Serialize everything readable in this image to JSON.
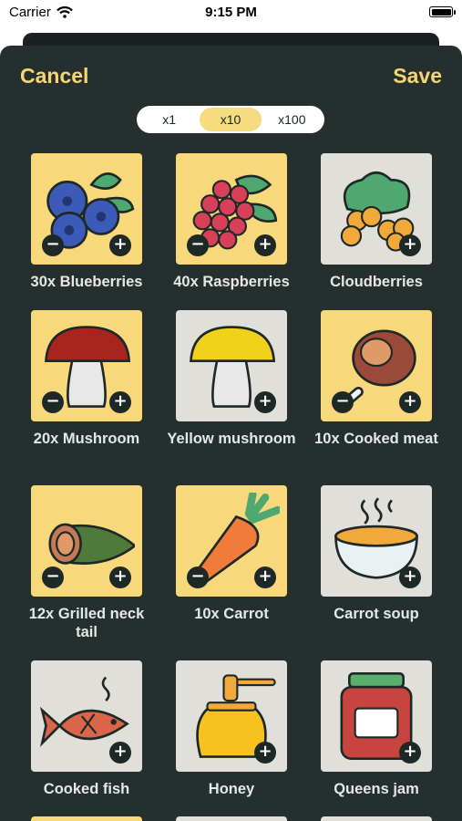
{
  "status_bar": {
    "carrier": "Carrier",
    "time": "9:15 PM"
  },
  "header": {
    "cancel_label": "Cancel",
    "save_label": "Save"
  },
  "multiplier": {
    "options": [
      "x1",
      "x10",
      "x100"
    ],
    "selected": "x10"
  },
  "items": [
    {
      "label": "30x Blueberries",
      "icon": "blueberries-icon",
      "selected": true
    },
    {
      "label": "40x Raspberries",
      "icon": "raspberries-icon",
      "selected": true
    },
    {
      "label": "Cloudberries",
      "icon": "cloudberries-icon",
      "selected": false
    },
    {
      "label": "20x Mushroom",
      "icon": "red-mushroom-icon",
      "selected": true
    },
    {
      "label": "Yellow mushroom",
      "icon": "yellow-mushroom-icon",
      "selected": false
    },
    {
      "label": "10x Cooked meat",
      "icon": "cooked-meat-icon",
      "selected": true
    },
    {
      "label": "12x Grilled neck tail",
      "icon": "grilled-neck-tail-icon",
      "selected": true
    },
    {
      "label": "10x Carrot",
      "icon": "carrot-icon",
      "selected": true
    },
    {
      "label": "Carrot soup",
      "icon": "carrot-soup-icon",
      "selected": false
    },
    {
      "label": "Cooked fish",
      "icon": "cooked-fish-icon",
      "selected": false
    },
    {
      "label": "Honey",
      "icon": "honey-jar-icon",
      "selected": false
    },
    {
      "label": "Queens jam",
      "icon": "jam-jar-icon",
      "selected": false
    }
  ],
  "colors": {
    "accent": "#f4d675",
    "background": "#252f2d",
    "tile_selected": "#f7d97c",
    "tile_unselected": "#e1dfd9"
  }
}
